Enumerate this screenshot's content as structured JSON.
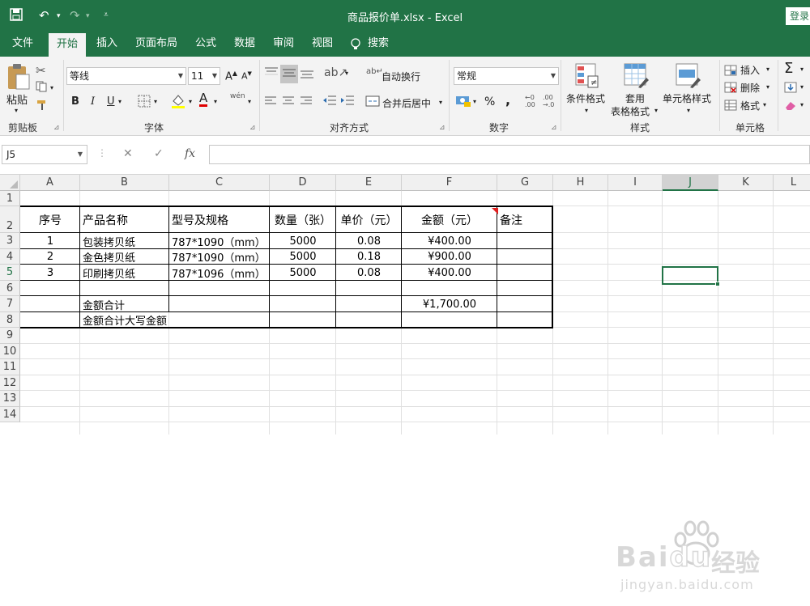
{
  "window": {
    "title": "商品报价单.xlsx - Excel",
    "login_label": "登录"
  },
  "ribbon_tabs": [
    "文件",
    "开始",
    "插入",
    "页面布局",
    "公式",
    "数据",
    "审阅",
    "视图",
    "搜索"
  ],
  "ribbon": {
    "clipboard": {
      "paste": "粘贴",
      "label": "剪贴板"
    },
    "font": {
      "name": "等线",
      "size": "11",
      "label": "字体",
      "bold": "B",
      "italic": "I",
      "underline": "U",
      "grow": "A",
      "shrink": "A",
      "font_color": "A",
      "phonetic": "wén"
    },
    "alignment": {
      "wrap": "自动换行",
      "merge": "合并后居中",
      "label": "对齐方式"
    },
    "number": {
      "format": "常规",
      "percent": "%",
      "comma": ",",
      "label": "数字"
    },
    "styles": {
      "conditional": "条件格式",
      "table_format_1": "套用",
      "table_format_2": "表格格式",
      "cell_styles": "单元格样式",
      "label": "样式"
    },
    "cells": {
      "insert": "插入",
      "delete": "删除",
      "format": "格式",
      "label": "单元格"
    },
    "editing": {
      "sum": "Σ"
    }
  },
  "formula_bar": {
    "name_box": "J5",
    "fx": "fx",
    "cancel": "✕",
    "enter": "✓",
    "formula": ""
  },
  "columns": [
    "A",
    "B",
    "C",
    "D",
    "E",
    "F",
    "G",
    "H",
    "I",
    "J",
    "K",
    "L"
  ],
  "rows": [
    "1",
    "2",
    "3",
    "4",
    "5",
    "6",
    "7",
    "8",
    "9",
    "10",
    "11",
    "12",
    "13",
    "14"
  ],
  "selected_cell": "J5",
  "table": {
    "headers": [
      "序号",
      "产品名称",
      "型号及规格",
      "数量（张）",
      "单价（元）",
      "金额（元）",
      "备注"
    ],
    "rows": [
      [
        "1",
        "包装拷贝纸",
        "787*1090（mm）",
        "5000",
        "0.08",
        "¥400.00",
        ""
      ],
      [
        "2",
        "金色拷贝纸",
        "787*1090（mm）",
        "5000",
        "0.18",
        "¥900.00",
        ""
      ],
      [
        "3",
        "印刷拷贝纸",
        "787*1096（mm）",
        "5000",
        "0.08",
        "¥400.00",
        ""
      ]
    ],
    "total_label": "金额合计",
    "total_value": "¥1,700.00",
    "total_caps_label": "金额合计大写金额"
  },
  "watermark": {
    "brand": "Bai",
    "brand2": "du",
    "suffix": "经验",
    "url": "jingyan.baidu.com"
  },
  "colors": {
    "accent": "#217346",
    "ribbon_bg": "#f3f3f3",
    "comment_flag": "#e02020"
  }
}
